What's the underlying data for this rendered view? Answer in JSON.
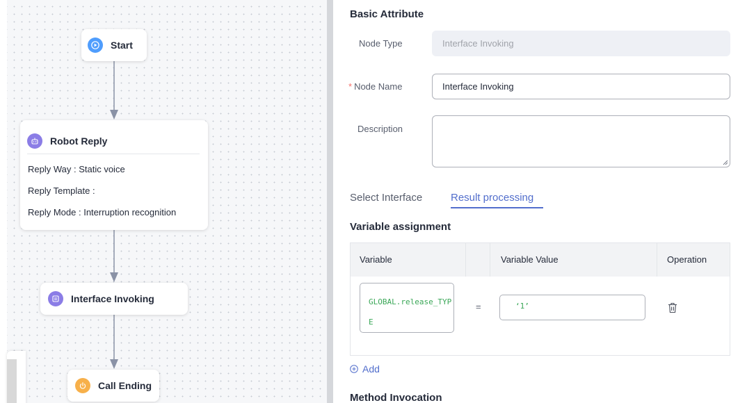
{
  "flow": {
    "nodes": {
      "start": {
        "label": "Start",
        "icon": "play-icon",
        "color": "#4f9dfd"
      },
      "robot_reply": {
        "label": "Robot Reply",
        "icon": "robot-icon",
        "color": "#7b6ee0",
        "rows": [
          {
            "text": "Reply Way :  Static voice"
          },
          {
            "text": "Reply Template :"
          },
          {
            "text": "Reply Mode :  Interruption recognition"
          }
        ]
      },
      "interface_invoking": {
        "label": "Interface Invoking",
        "icon": "interface-icon",
        "color": "#8b7de6"
      },
      "call_ending": {
        "label": "Call Ending",
        "icon": "power-icon",
        "color": "#f7b04a"
      }
    }
  },
  "panel": {
    "basic_attribute_title": "Basic Attribute",
    "node_type": {
      "label": "Node Type",
      "value": "Interface Invoking"
    },
    "node_name": {
      "required_mark": "*",
      "label": "Node Name",
      "value": "Interface Invoking"
    },
    "description": {
      "label": "Description",
      "value": ""
    },
    "tabs": [
      {
        "label": "Select Interface",
        "active": false
      },
      {
        "label": "Result processing",
        "active": true
      }
    ],
    "variable_assignment_title": "Variable assignment",
    "table": {
      "headers": {
        "variable": "Variable",
        "variable_value": "Variable Value",
        "operation": "Operation"
      },
      "rows": [
        {
          "variable": "GLOBAL.release_TYPE",
          "operator": "=",
          "value": "‘1’"
        }
      ]
    },
    "add_label": "Add",
    "method_invocation_title": "Method Invocation"
  },
  "colors": {
    "accent": "#526ecc",
    "code_text": "#3aa757",
    "required": "#f66f6a"
  }
}
